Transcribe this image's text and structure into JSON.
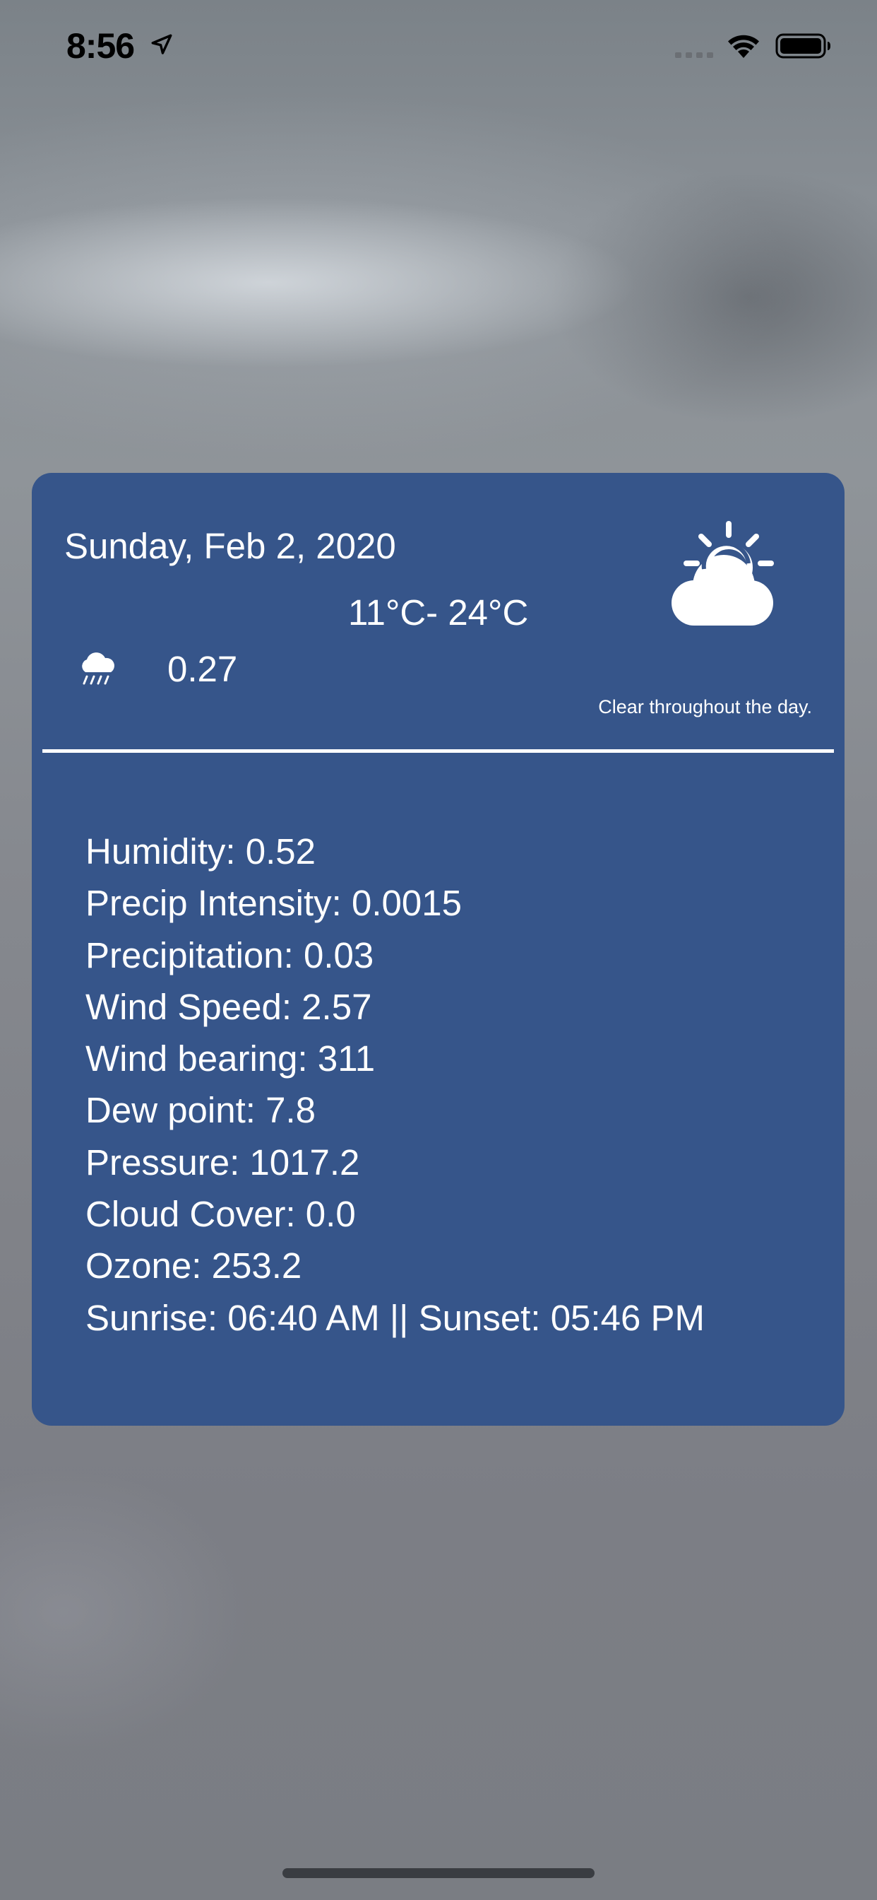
{
  "status_bar": {
    "time": "8:56"
  },
  "card": {
    "date": "Sunday, Feb 2, 2020",
    "temp_range": "11°C- 24°C",
    "precip_probability": "0.27",
    "summary": "Clear throughout the day.",
    "weather_icon": "partly-cloudy-day-icon",
    "precip_icon": "rain-cloud-icon"
  },
  "details": [
    "Humidity: 0.52",
    "Precip Intensity: 0.0015",
    "Precipitation: 0.03",
    "Wind Speed: 2.57",
    "Wind bearing: 311",
    "Dew point: 7.8",
    "Pressure: 1017.2",
    "Cloud Cover: 0.0",
    "Ozone: 253.2",
    "Sunrise: 06:40 AM || Sunset: 05:46 PM"
  ],
  "colors": {
    "card_background": "#36558a",
    "card_text": "#ffffff"
  }
}
